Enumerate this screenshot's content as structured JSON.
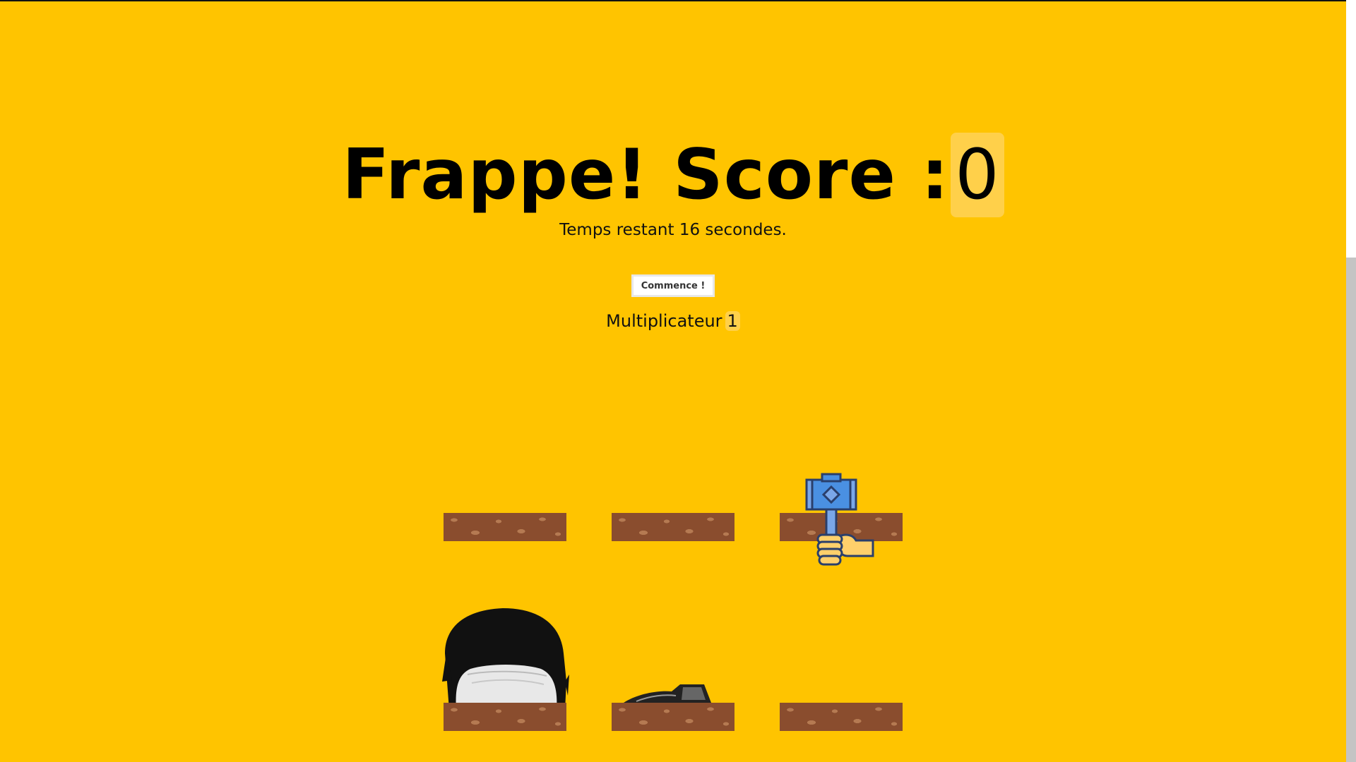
{
  "game": {
    "title_text": "Frappe! Score :",
    "score": "0",
    "timer_text": "Temps restant 16 secondes.",
    "start_button_label": "Commence !",
    "multiplier_label": "Multiplicateur",
    "multiplier_value": "1"
  },
  "board": {
    "rows": 2,
    "cols": 3,
    "holes": [
      {
        "row": 1,
        "col": 1,
        "occupant": "none"
      },
      {
        "row": 1,
        "col": 2,
        "occupant": "none"
      },
      {
        "row": 1,
        "col": 3,
        "occupant": "hammer"
      },
      {
        "row": 2,
        "col": 1,
        "occupant": "head-rising"
      },
      {
        "row": 2,
        "col": 2,
        "occupant": "head-peeking"
      },
      {
        "row": 2,
        "col": 3,
        "occupant": "none"
      }
    ]
  },
  "colors": {
    "background": "#ffc400",
    "dirt": "#8a4d2e",
    "dirt_spots": "#b57a52",
    "hammer_head": "#4a90e2",
    "hand": "#ffd06b"
  },
  "icons": {
    "cursor": "hammer-hand-icon"
  }
}
